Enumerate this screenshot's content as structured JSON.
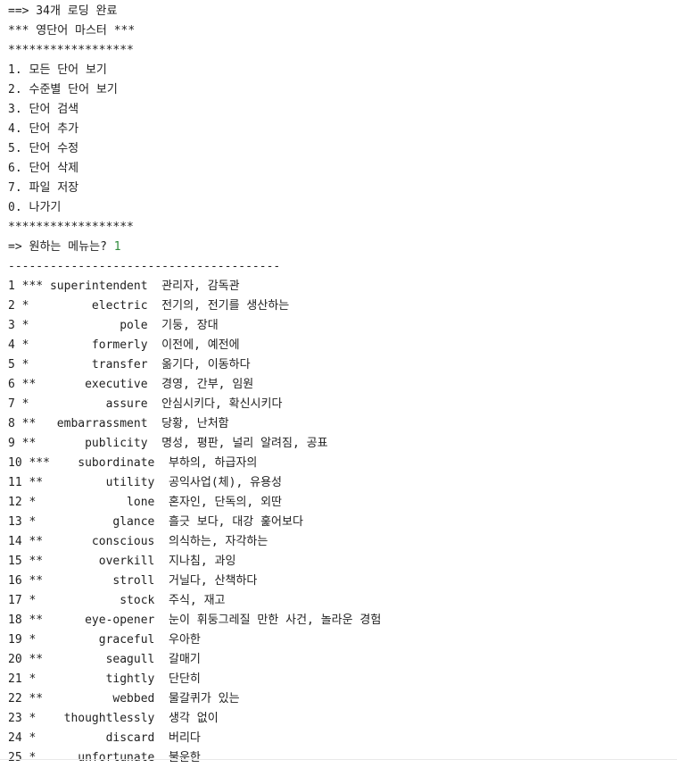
{
  "console": {
    "load_message": "==> 34개 로딩 완료",
    "title": "*** 영단어 마스터 ***",
    "separator_stars": "******************",
    "menu": [
      "1. 모든 단어 보기",
      "2. 수준별 단어 보기",
      "3. 단어 검색",
      "4. 단어 추가",
      "5. 단어 수정",
      "6. 단어 삭제",
      "7. 파일 저장",
      "0. 나가기"
    ],
    "prompt": "=> 원하는 메뉴는? ",
    "user_input": "1",
    "dash_separator": "---------------------------------------",
    "words": [
      "1 *** superintendent  관리자, 감독관",
      "2 *         electric  전기의, 전기를 생산하는",
      "3 *             pole  기둥, 장대",
      "4 *         formerly  이전에, 예전에",
      "5 *         transfer  옮기다, 이동하다",
      "6 **       executive  경영, 간부, 임원",
      "7 *           assure  안심시키다, 확신시키다",
      "8 **   embarrassment  당황, 난처함",
      "9 **       publicity  명성, 평판, 널리 알려짐, 공표",
      "10 ***    subordinate  부하의, 하급자의",
      "11 **         utility  공익사업(체), 유용성",
      "12 *             lone  혼자인, 단독의, 외딴",
      "13 *           glance  흘긋 보다, 대강 훑어보다",
      "14 **       conscious  의식하는, 자각하는",
      "15 **        overkill  지나침, 과잉",
      "16 **          stroll  거닐다, 산책하다",
      "17 *            stock  주식, 재고",
      "18 **      eye-opener  눈이 휘둥그레질 만한 사건, 놀라운 경험",
      "19 *         graceful  우아한",
      "20 **         seagull  갈매기",
      "21 *          tightly  단단히",
      "22 **          webbed  물갈퀴가 있는",
      "23 *    thoughtlessly  생각 없이",
      "24 *          discard  버리다",
      "25 *      unfortunate  불운한"
    ]
  }
}
